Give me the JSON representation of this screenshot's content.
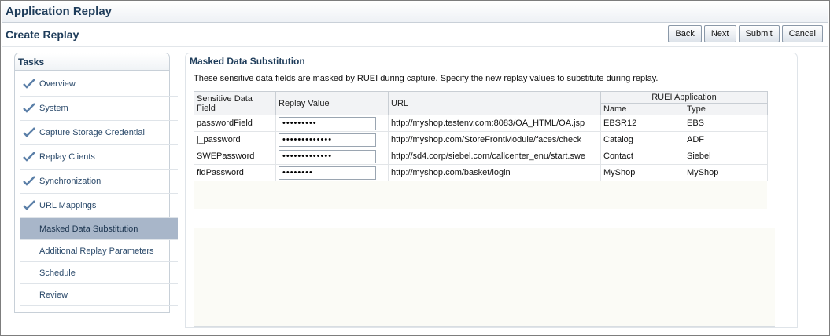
{
  "app": {
    "title": "Application Replay"
  },
  "page": {
    "title": "Create Replay"
  },
  "buttons": {
    "back": "Back",
    "next": "Next",
    "submit": "Submit",
    "cancel": "Cancel"
  },
  "tasks": {
    "title": "Tasks",
    "items": [
      {
        "label": "Overview",
        "completed": true
      },
      {
        "label": "System",
        "completed": true
      },
      {
        "label": "Capture Storage Credential",
        "completed": true
      },
      {
        "label": "Replay Clients",
        "completed": true
      },
      {
        "label": "Synchronization",
        "completed": true
      },
      {
        "label": "URL Mappings",
        "completed": true
      },
      {
        "label": "Masked Data Substitution",
        "active": true
      },
      {
        "label": "Additional Replay Parameters"
      },
      {
        "label": "Schedule"
      },
      {
        "label": "Review"
      }
    ]
  },
  "main": {
    "title": "Masked Data Substitution",
    "description": "These sensitive data fields are masked by RUEI during capture. Specify the new replay values to substitute during replay.",
    "table": {
      "headers": {
        "field": "Sensitive Data Field",
        "value": "Replay Value",
        "url": "URL",
        "ruei": "RUEI Application",
        "name": "Name",
        "type": "Type"
      },
      "rows": [
        {
          "field": "passwordField",
          "value": "•••••••••",
          "url": "http://myshop.testenv.com:8083/OA_HTML/OA.jsp",
          "name": "EBSR12",
          "type": "EBS"
        },
        {
          "field": "j_password",
          "value": "•••••••••••••",
          "url": "http://myshop.com/StoreFrontModule/faces/check",
          "name": "Catalog",
          "type": "ADF"
        },
        {
          "field": "SWEPassword",
          "value": "•••••••••••••",
          "url": "http://sd4.corp/siebel.com/callcenter_enu/start.swe",
          "name": "Contact",
          "type": "Siebel"
        },
        {
          "field": "fldPassword",
          "value": "••••••••",
          "url": "http://myshop.com/basket/login",
          "name": "MyShop",
          "type": "MyShop"
        }
      ]
    }
  },
  "colors": {
    "accent": "#1e3c5a",
    "active_task": "#a8b6c9",
    "check": "#5b7fa8"
  },
  "icons": {
    "completed": "checkmark-icon"
  }
}
